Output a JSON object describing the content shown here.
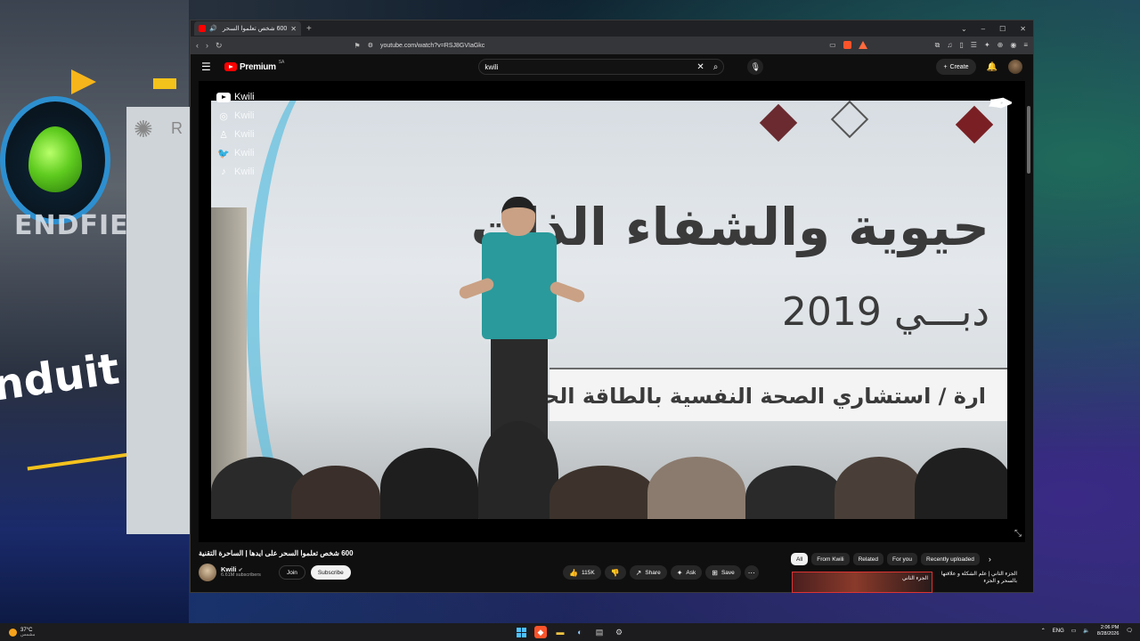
{
  "browser": {
    "tab_title": "600 شخص تعلموا السحر على",
    "tab_close": "✕",
    "new_tab": "+",
    "url": "youtube.com/watch?v=RSJ8GVIaGkc",
    "win_min": "–",
    "win_max": "☐",
    "win_close": "✕",
    "win_chevron": "⌄"
  },
  "youtube": {
    "brand": "Premium",
    "brand_sup": "SA",
    "search_query": "kwili",
    "create_label": "Create"
  },
  "overlay": {
    "socials": [
      {
        "icon": "youtube-icon",
        "label": "Kwili"
      },
      {
        "icon": "instagram-icon",
        "label": "Kwili"
      },
      {
        "icon": "snapchat-icon",
        "label": "Kwili"
      },
      {
        "icon": "twitter-icon",
        "label": "Kwili"
      },
      {
        "icon": "tiktok-icon",
        "label": "Kwili"
      }
    ],
    "banner_main": "حيوية والشفاء الذات",
    "banner_year": "دبـــي 2019",
    "banner_sub": "ارة / استشاري الصحة النفسية بالطاقة الحيوي"
  },
  "video_info": {
    "title": "600 شخص تعلموا السحر على ايدها | الساحرة التقنية",
    "channel_name": "Kwili",
    "channel_subs": "6.61M subscribers",
    "join_label": "Join",
    "subscribe_label": "Subscribe",
    "likes": "115K",
    "share_label": "Share",
    "ask_label": "Ask",
    "save_label": "Save"
  },
  "chips": [
    "All",
    "From Kwili",
    "Related",
    "For you",
    "Recently uploaded"
  ],
  "recommendation": {
    "thumb_text": "الجزء الثاني",
    "title": "الجزء الثاني | علم الشكلة و علاقتها بالسحر و الجزء"
  },
  "taskbar": {
    "temp": "37°C",
    "condition": "مشمس",
    "lang": "ENG",
    "time": "2:06 PM",
    "date": "8/28/2026"
  },
  "colors": {
    "youtube_red": "#ff0000",
    "banner_teal": "#2a9a9c",
    "desktop_accent": "#4cc2ff"
  }
}
